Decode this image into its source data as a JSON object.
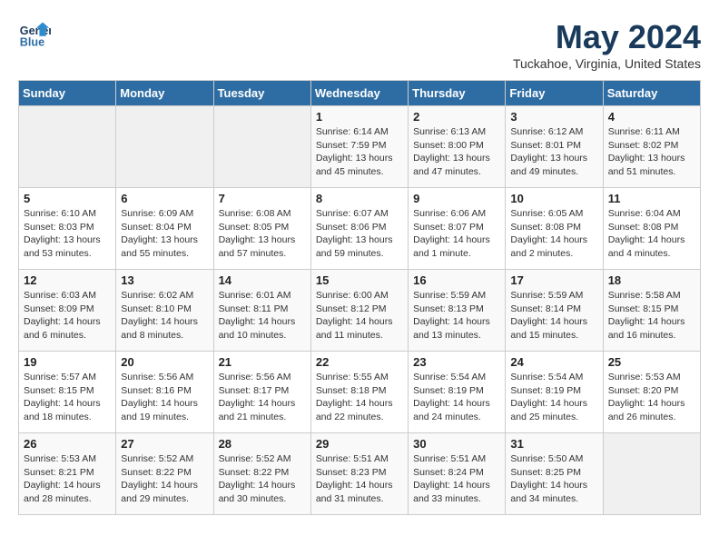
{
  "header": {
    "logo_line1": "General",
    "logo_line2": "Blue",
    "month": "May 2024",
    "location": "Tuckahoe, Virginia, United States"
  },
  "weekdays": [
    "Sunday",
    "Monday",
    "Tuesday",
    "Wednesday",
    "Thursday",
    "Friday",
    "Saturday"
  ],
  "weeks": [
    [
      {
        "day": "",
        "info": ""
      },
      {
        "day": "",
        "info": ""
      },
      {
        "day": "",
        "info": ""
      },
      {
        "day": "1",
        "info": "Sunrise: 6:14 AM\nSunset: 7:59 PM\nDaylight: 13 hours\nand 45 minutes."
      },
      {
        "day": "2",
        "info": "Sunrise: 6:13 AM\nSunset: 8:00 PM\nDaylight: 13 hours\nand 47 minutes."
      },
      {
        "day": "3",
        "info": "Sunrise: 6:12 AM\nSunset: 8:01 PM\nDaylight: 13 hours\nand 49 minutes."
      },
      {
        "day": "4",
        "info": "Sunrise: 6:11 AM\nSunset: 8:02 PM\nDaylight: 13 hours\nand 51 minutes."
      }
    ],
    [
      {
        "day": "5",
        "info": "Sunrise: 6:10 AM\nSunset: 8:03 PM\nDaylight: 13 hours\nand 53 minutes."
      },
      {
        "day": "6",
        "info": "Sunrise: 6:09 AM\nSunset: 8:04 PM\nDaylight: 13 hours\nand 55 minutes."
      },
      {
        "day": "7",
        "info": "Sunrise: 6:08 AM\nSunset: 8:05 PM\nDaylight: 13 hours\nand 57 minutes."
      },
      {
        "day": "8",
        "info": "Sunrise: 6:07 AM\nSunset: 8:06 PM\nDaylight: 13 hours\nand 59 minutes."
      },
      {
        "day": "9",
        "info": "Sunrise: 6:06 AM\nSunset: 8:07 PM\nDaylight: 14 hours\nand 1 minute."
      },
      {
        "day": "10",
        "info": "Sunrise: 6:05 AM\nSunset: 8:08 PM\nDaylight: 14 hours\nand 2 minutes."
      },
      {
        "day": "11",
        "info": "Sunrise: 6:04 AM\nSunset: 8:08 PM\nDaylight: 14 hours\nand 4 minutes."
      }
    ],
    [
      {
        "day": "12",
        "info": "Sunrise: 6:03 AM\nSunset: 8:09 PM\nDaylight: 14 hours\nand 6 minutes."
      },
      {
        "day": "13",
        "info": "Sunrise: 6:02 AM\nSunset: 8:10 PM\nDaylight: 14 hours\nand 8 minutes."
      },
      {
        "day": "14",
        "info": "Sunrise: 6:01 AM\nSunset: 8:11 PM\nDaylight: 14 hours\nand 10 minutes."
      },
      {
        "day": "15",
        "info": "Sunrise: 6:00 AM\nSunset: 8:12 PM\nDaylight: 14 hours\nand 11 minutes."
      },
      {
        "day": "16",
        "info": "Sunrise: 5:59 AM\nSunset: 8:13 PM\nDaylight: 14 hours\nand 13 minutes."
      },
      {
        "day": "17",
        "info": "Sunrise: 5:59 AM\nSunset: 8:14 PM\nDaylight: 14 hours\nand 15 minutes."
      },
      {
        "day": "18",
        "info": "Sunrise: 5:58 AM\nSunset: 8:15 PM\nDaylight: 14 hours\nand 16 minutes."
      }
    ],
    [
      {
        "day": "19",
        "info": "Sunrise: 5:57 AM\nSunset: 8:15 PM\nDaylight: 14 hours\nand 18 minutes."
      },
      {
        "day": "20",
        "info": "Sunrise: 5:56 AM\nSunset: 8:16 PM\nDaylight: 14 hours\nand 19 minutes."
      },
      {
        "day": "21",
        "info": "Sunrise: 5:56 AM\nSunset: 8:17 PM\nDaylight: 14 hours\nand 21 minutes."
      },
      {
        "day": "22",
        "info": "Sunrise: 5:55 AM\nSunset: 8:18 PM\nDaylight: 14 hours\nand 22 minutes."
      },
      {
        "day": "23",
        "info": "Sunrise: 5:54 AM\nSunset: 8:19 PM\nDaylight: 14 hours\nand 24 minutes."
      },
      {
        "day": "24",
        "info": "Sunrise: 5:54 AM\nSunset: 8:19 PM\nDaylight: 14 hours\nand 25 minutes."
      },
      {
        "day": "25",
        "info": "Sunrise: 5:53 AM\nSunset: 8:20 PM\nDaylight: 14 hours\nand 26 minutes."
      }
    ],
    [
      {
        "day": "26",
        "info": "Sunrise: 5:53 AM\nSunset: 8:21 PM\nDaylight: 14 hours\nand 28 minutes."
      },
      {
        "day": "27",
        "info": "Sunrise: 5:52 AM\nSunset: 8:22 PM\nDaylight: 14 hours\nand 29 minutes."
      },
      {
        "day": "28",
        "info": "Sunrise: 5:52 AM\nSunset: 8:22 PM\nDaylight: 14 hours\nand 30 minutes."
      },
      {
        "day": "29",
        "info": "Sunrise: 5:51 AM\nSunset: 8:23 PM\nDaylight: 14 hours\nand 31 minutes."
      },
      {
        "day": "30",
        "info": "Sunrise: 5:51 AM\nSunset: 8:24 PM\nDaylight: 14 hours\nand 33 minutes."
      },
      {
        "day": "31",
        "info": "Sunrise: 5:50 AM\nSunset: 8:25 PM\nDaylight: 14 hours\nand 34 minutes."
      },
      {
        "day": "",
        "info": ""
      }
    ]
  ]
}
